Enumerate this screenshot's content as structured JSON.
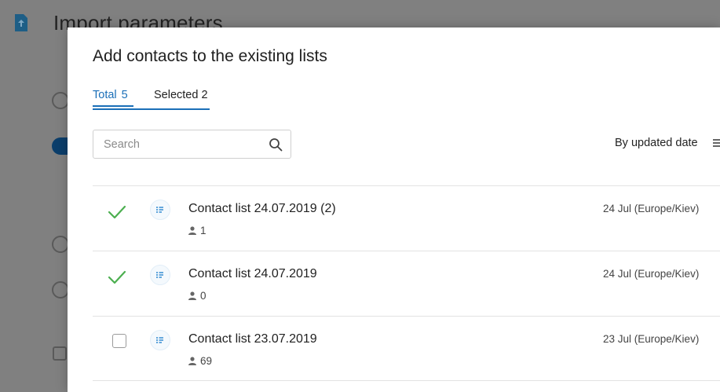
{
  "background": {
    "title": "Import parameters"
  },
  "modal": {
    "title": "Add contacts to the existing lists",
    "tabs": {
      "total_label": "Total",
      "total_count": "5",
      "selected_label": "Selected 2"
    },
    "search": {
      "placeholder": "Search",
      "value": ""
    },
    "sort": {
      "label": "By updated date"
    },
    "lists": [
      {
        "name": "Contact list 24.07.2019 (2)",
        "count": "1",
        "date": "24 Jul (Europe/Kiev)",
        "selected": true
      },
      {
        "name": "Contact list 24.07.2019",
        "count": "0",
        "date": "24 Jul (Europe/Kiev)",
        "selected": true
      },
      {
        "name": "Contact list 23.07.2019",
        "count": "69",
        "date": "23 Jul (Europe/Kiev)",
        "selected": false
      }
    ]
  },
  "colors": {
    "accent": "#1b6fb8",
    "check": "#4caf50",
    "overlay": "#808080"
  },
  "icons": {
    "check": "check-icon",
    "list": "list-icon",
    "person": "person-icon",
    "search": "search-icon",
    "sort": "sort-icon",
    "file": "file-upload-icon"
  }
}
